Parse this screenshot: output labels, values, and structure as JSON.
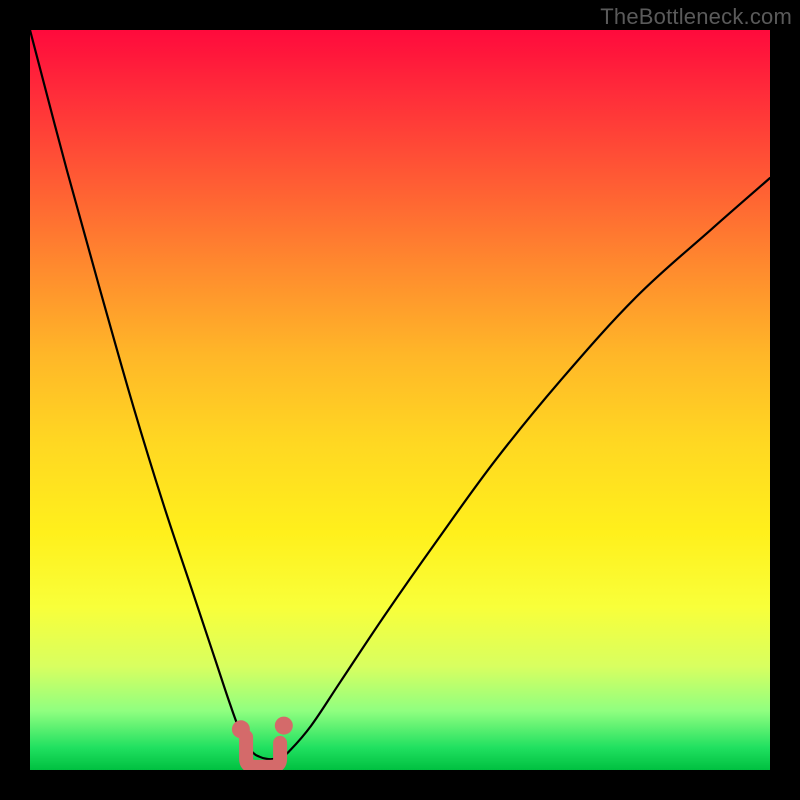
{
  "watermark": "TheBottleneck.com",
  "chart_data": {
    "type": "line",
    "title": "",
    "xlabel": "",
    "ylabel": "",
    "xlim": [
      0,
      100
    ],
    "ylim": [
      0,
      100
    ],
    "grid": false,
    "legend": false,
    "series": [
      {
        "name": "bottleneck-curve",
        "x": [
          0,
          5,
          10,
          14,
          18,
          22,
          25,
          27,
          28.5,
          30,
          31,
          32,
          33,
          34,
          35,
          38,
          42,
          48,
          55,
          63,
          72,
          82,
          92,
          100
        ],
        "values": [
          100,
          81,
          63,
          49,
          36,
          24,
          15,
          9,
          5,
          2.5,
          1.8,
          1.5,
          1.5,
          1.8,
          2.5,
          6,
          12,
          21,
          31,
          42,
          53,
          64,
          73,
          80
        ]
      }
    ],
    "markers": [
      {
        "name": "marker-left-dot",
        "x": 28.5,
        "y": 5.5,
        "color": "#d46a6a",
        "shape": "circle"
      },
      {
        "name": "marker-right-dot",
        "x": 34.3,
        "y": 6.0,
        "color": "#d46a6a",
        "shape": "circle"
      },
      {
        "name": "marker-trough",
        "x": 31.5,
        "y": 1.5,
        "color": "#d46a6a",
        "shape": "u"
      }
    ],
    "colors": {
      "curve": "#000000",
      "marker": "#d46a6a",
      "background_top": "#ff0a3c",
      "background_bottom": "#00c040",
      "frame": "#000000"
    }
  }
}
